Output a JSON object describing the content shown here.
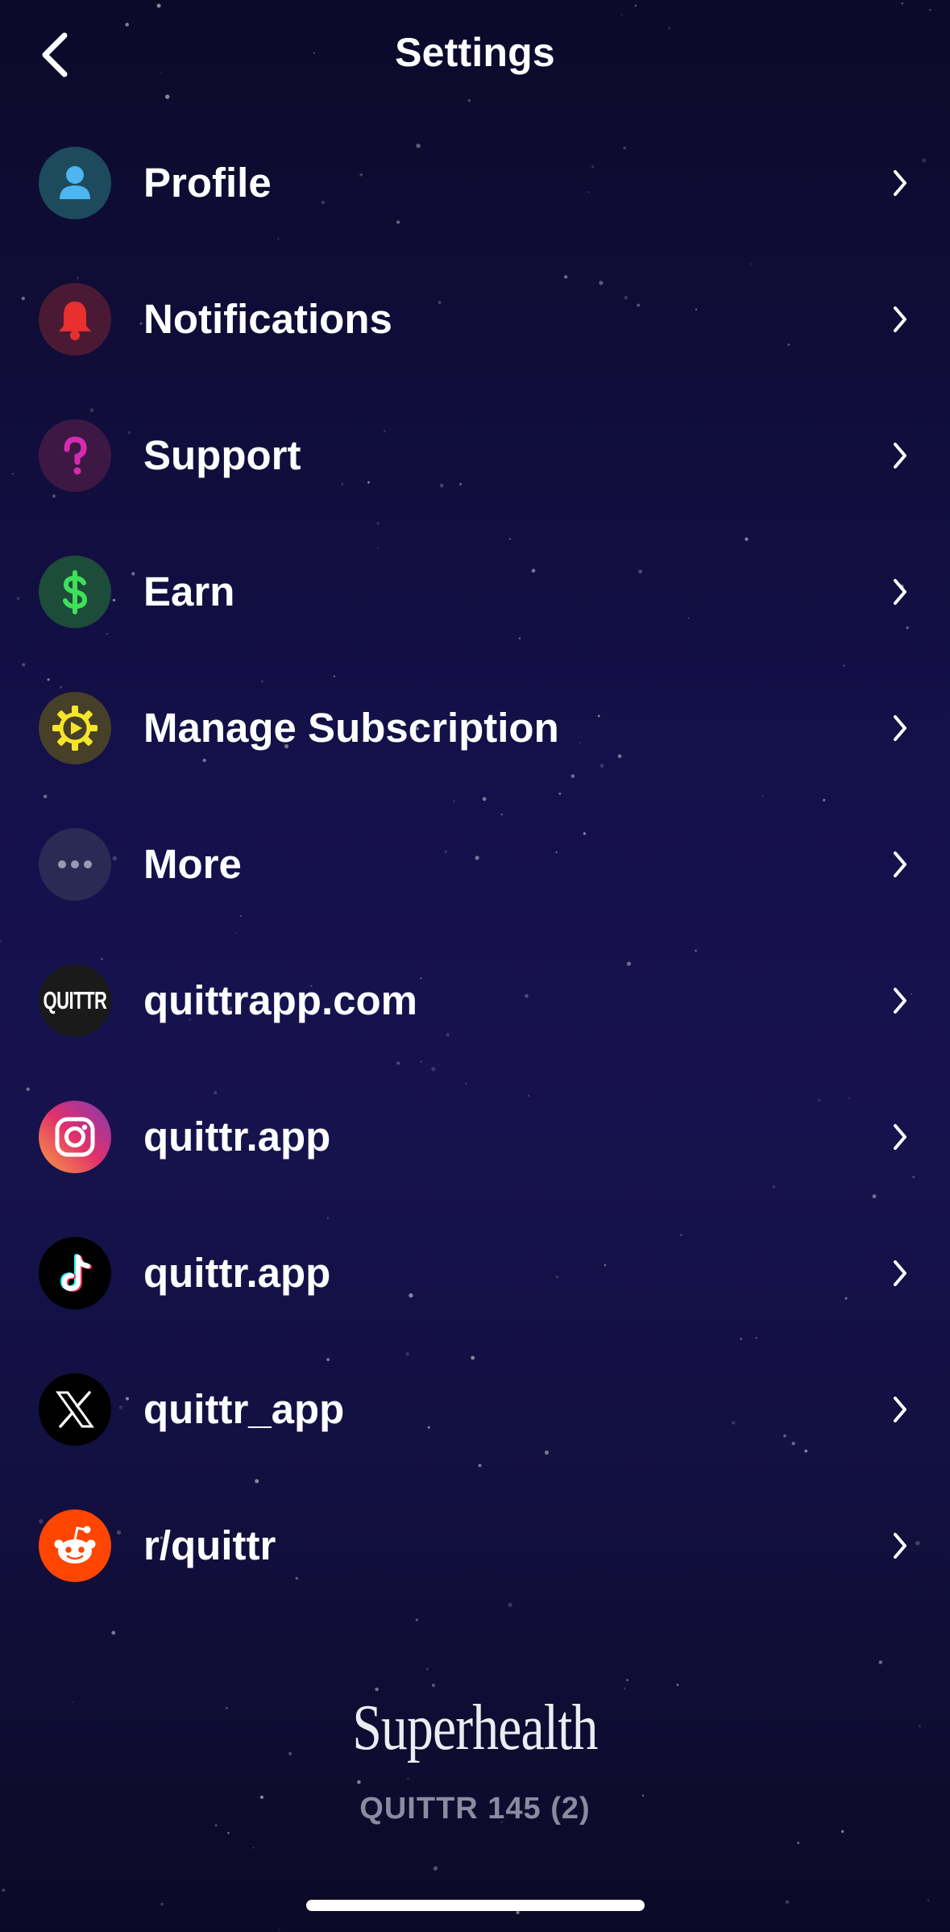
{
  "header": {
    "title": "Settings"
  },
  "rows": [
    {
      "label": "Profile",
      "icon": "person-icon",
      "bg": "#1d4a5c"
    },
    {
      "label": "Notifications",
      "icon": "bell-icon",
      "bg": "#4a1a35"
    },
    {
      "label": "Support",
      "icon": "question-icon",
      "bg": "#3e1845"
    },
    {
      "label": "Earn",
      "icon": "dollar-icon",
      "bg": "#1d4c3a"
    },
    {
      "label": "Manage Subscription",
      "icon": "gear-icon",
      "bg": "#464028"
    },
    {
      "label": "More",
      "icon": "ellipsis-icon",
      "bg": "#2b2a55"
    },
    {
      "label": "quittrapp.com",
      "icon": "quittr-logo-icon",
      "bg": "#1a1a1a"
    },
    {
      "label": "quittr.app",
      "icon": "instagram-icon",
      "bg": "#c13584"
    },
    {
      "label": "quittr.app",
      "icon": "tiktok-icon",
      "bg": "#000000"
    },
    {
      "label": "quittr_app",
      "icon": "x-logo-icon",
      "bg": "#000000"
    },
    {
      "label": "r/quittr",
      "icon": "reddit-icon",
      "bg": "#ff4500"
    }
  ],
  "logo_text": "QUITTR",
  "footer": {
    "brand": "Superhealth",
    "version": "QUITTR 145 (2)"
  },
  "colors": {
    "accent_green": "#3ee05a",
    "accent_yellow": "#f5e52a",
    "accent_red": "#e8302f",
    "accent_pink": "#d62bb0",
    "accent_blue": "#4db5f0"
  }
}
